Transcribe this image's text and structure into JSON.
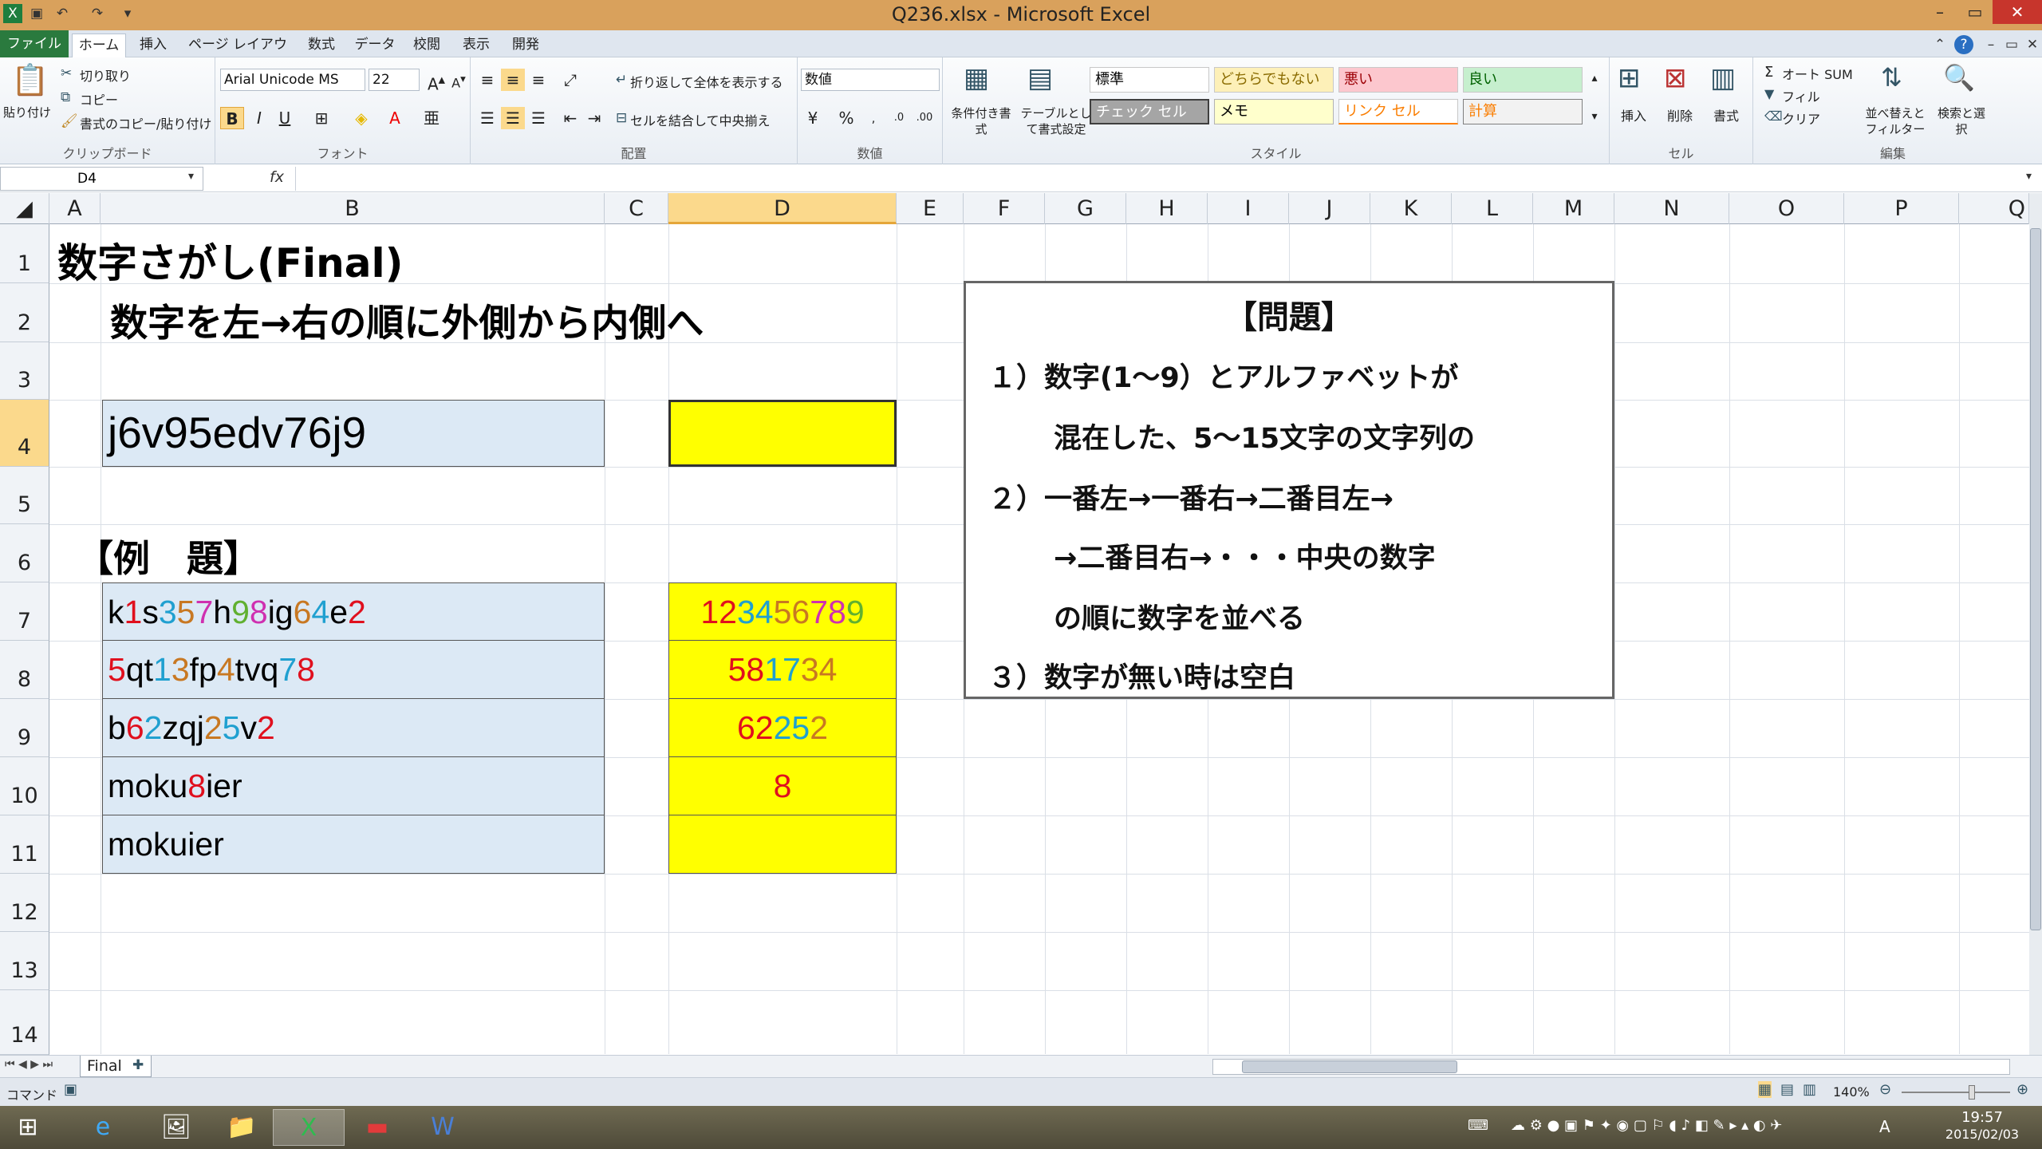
{
  "window": {
    "title": "Q236.xlsx - Microsoft Excel",
    "min": "–",
    "restore": "▭",
    "close": "✕"
  },
  "tabs": [
    "ファイル",
    "ホーム",
    "挿入",
    "ページ レイアウト",
    "数式",
    "データ",
    "校閲",
    "表示",
    "開発"
  ],
  "ribbon": {
    "clipboard": {
      "paste": "貼り付け",
      "cut": "切り取り",
      "copy": "コピー",
      "format_painter": "書式のコピー/貼り付け",
      "label": "クリップボード"
    },
    "font": {
      "name": "Arial Unicode MS",
      "size": "22",
      "label": "フォント",
      "bold": "B",
      "italic": "I",
      "underline": "U"
    },
    "alignment": {
      "wrap": "折り返して全体を表示する",
      "merge": "セルを結合して中央揃え",
      "label": "配置"
    },
    "number": {
      "format": "数値",
      "label": "数値",
      "percent": "%"
    },
    "styles": {
      "conditional": "条件付き書式",
      "table": "テーブルとして書式設定",
      "cells": [
        "標準",
        "どちらでもない",
        "悪い",
        "良い",
        "チェック セル",
        "メモ",
        "リンク セル",
        "計算"
      ],
      "label": "スタイル"
    },
    "cells": {
      "insert": "挿入",
      "delete": "削除",
      "format": "書式",
      "label": "セル"
    },
    "editing": {
      "autosum": "オート SUM",
      "fill": "フィル",
      "clear": "クリア",
      "sort": "並べ替えとフィルター",
      "find": "検索と選択",
      "label": "編集"
    }
  },
  "formula_bar": {
    "namebox": "D4",
    "fx": "fx",
    "value": ""
  },
  "columns": [
    "A",
    "B",
    "C",
    "D",
    "E",
    "F",
    "G",
    "H",
    "I",
    "J",
    "K",
    "L",
    "M",
    "N",
    "O",
    "P",
    "Q"
  ],
  "rows": [
    "1",
    "2",
    "3",
    "4",
    "5",
    "6",
    "7",
    "8",
    "9",
    "10",
    "11",
    "12",
    "13",
    "14"
  ],
  "sheet": {
    "title": "数字さがし(Final)",
    "subtitle": "数字を左→右の順に外側から内側へ",
    "input": "j6v95edv76j9",
    "example_heading": "【例　題】",
    "examples": [
      {
        "input": "k1s357h98ig64e2",
        "output": "123456789"
      },
      {
        "input": "5qt13fp4tvq78",
        "output": "581734"
      },
      {
        "input": "b62zqj25v2",
        "output": "62252"
      },
      {
        "input": "moku8ier",
        "output": "8"
      },
      {
        "input": "mokuier",
        "output": ""
      }
    ],
    "problem": {
      "heading": "【問題】",
      "lines": [
        "１）数字(1～9）とアルファベットが",
        "混在した、5～15文字の文字列の",
        "２）一番左→一番右→二番目左→",
        "→二番目右→・・・中央の数字",
        "の順に数字を並べる",
        "３）数字が無い時は空白"
      ]
    }
  },
  "sheet_tabs": {
    "active": "Final"
  },
  "status": {
    "mode": "コマンド",
    "zoom": "140%"
  },
  "taskbar": {
    "time": "19:57",
    "date": "2015/02/03"
  }
}
